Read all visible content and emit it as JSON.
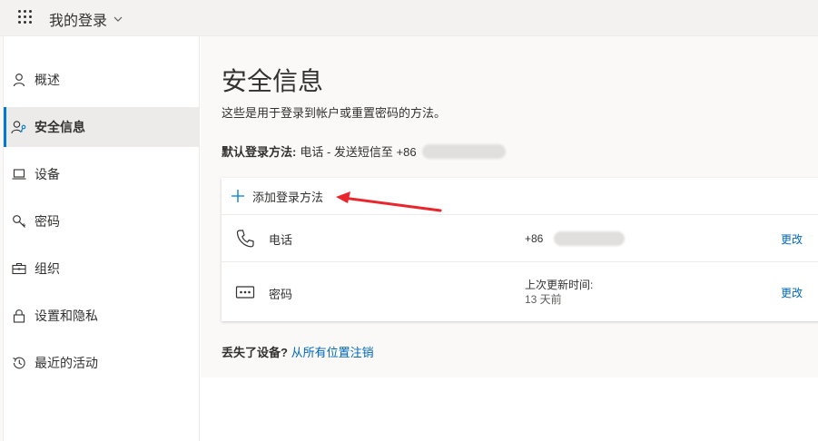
{
  "header": {
    "app_title": "我的登录",
    "icons": [
      "waffle-icon",
      "chevron-down-icon"
    ]
  },
  "sidebar": {
    "items": [
      {
        "label": "概述",
        "icon": "person-icon"
      },
      {
        "label": "安全信息",
        "icon": "person-key-icon",
        "active": true
      },
      {
        "label": "设备",
        "icon": "laptop-icon"
      },
      {
        "label": "密码",
        "icon": "key-icon"
      },
      {
        "label": "组织",
        "icon": "briefcase-icon"
      },
      {
        "label": "设置和隐私",
        "icon": "lock-icon"
      },
      {
        "label": "最近的活动",
        "icon": "history-icon"
      }
    ]
  },
  "main": {
    "title": "安全信息",
    "subtitle": "这些是用于登录到帐户或重置密码的方法。",
    "default_method_label": "默认登录方法:",
    "default_method_value": "电话 - 发送短信至 +86",
    "add_method_label": "添加登录方法",
    "methods": [
      {
        "name": "电话",
        "icon": "phone-icon",
        "value": "+86",
        "action": "更改"
      },
      {
        "name": "密码",
        "icon": "password-dots-icon",
        "value_line1": "上次更新时间:",
        "value_line2": "13 天前",
        "action": "更改"
      }
    ],
    "lost_device_label": "丢失了设备?",
    "lost_device_link": "从所有位置注销"
  },
  "colors": {
    "accent": "#0078d4",
    "link": "#0067b8",
    "annotation_arrow": "#e8262b"
  }
}
